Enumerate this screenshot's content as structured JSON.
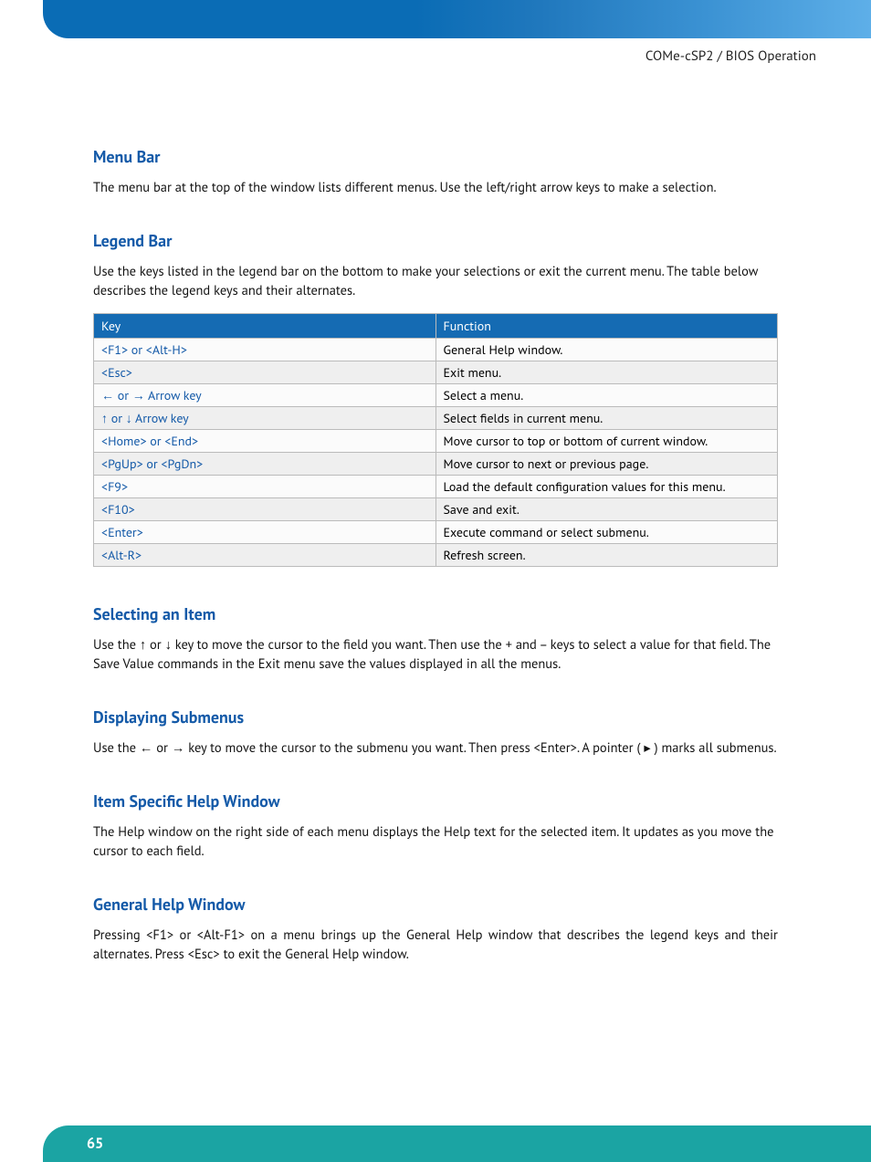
{
  "header": {
    "breadcrumb": "COMe-cSP2 / BIOS Operation"
  },
  "sections": {
    "menu_bar": {
      "title": "Menu Bar",
      "body": "The menu bar at the top of the window lists different menus. Use the left/right arrow keys to make a selection."
    },
    "legend_bar": {
      "title": "Legend Bar",
      "body": "Use the keys listed in the legend bar on the bottom to make your selections or exit the current menu. The table below describes the legend keys and their alternates.",
      "table": {
        "head_key": "Key",
        "head_func": "Function",
        "rows": [
          {
            "key": "<F1> or <Alt-H>",
            "func": "General Help window."
          },
          {
            "key": "<Esc>",
            "func": "Exit menu."
          },
          {
            "key": "← or → Arrow key",
            "func": "Select a menu."
          },
          {
            "key": "↑ or ↓ Arrow key",
            "func": "Select fields in current menu."
          },
          {
            "key": "<Home> or <End>",
            "func": "Move cursor to top or bottom of current window."
          },
          {
            "key": "<PgUp> or <PgDn>",
            "func": "Move cursor to next or previous page."
          },
          {
            "key": "<F9>",
            "func": "Load the default configuration values for this menu."
          },
          {
            "key": "<F10>",
            "func": "Save and exit."
          },
          {
            "key": "<Enter>",
            "func": "Execute command or select submenu."
          },
          {
            "key": "<Alt-R>",
            "func": "Refresh screen."
          }
        ]
      }
    },
    "selecting": {
      "title": "Selecting an Item",
      "body": "Use the ↑ or ↓ key to move the cursor to the field you want. Then use the + and – keys to select a value for that field. The Save Value commands in the Exit menu save the values displayed in all the menus."
    },
    "submenus": {
      "title": "Displaying Submenus",
      "body": "Use the ← or → key to move the cursor to the submenu you want. Then press <Enter>. A pointer ( ▸ ) marks all submenus."
    },
    "item_help": {
      "title": "Item Specific Help Window",
      "body": "The Help window on the right side of each menu displays the Help text for the selected item. It updates as you move the cursor to each field."
    },
    "gen_help": {
      "title": "General Help Window",
      "body": "Pressing <F1> or <Alt-F1> on a menu brings up the General Help window that describes the legend keys and their alternates. Press <Esc> to exit the General Help window."
    }
  },
  "footer": {
    "page_number": "65"
  }
}
